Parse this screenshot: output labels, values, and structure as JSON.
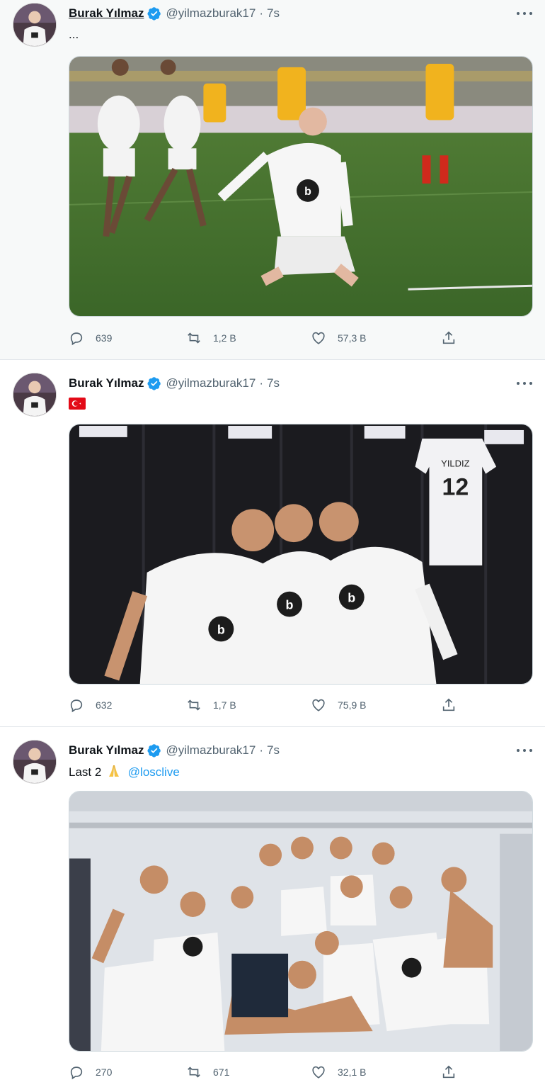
{
  "tweets": [
    {
      "author_name": "Burak Yılmaz",
      "handle": "@yilmazburak17",
      "separator": "·",
      "time": "7s",
      "text": "...",
      "media_icon": "photo-goal-celebration",
      "replies": "639",
      "retweets": "1,2 B",
      "likes": "57,3 B"
    },
    {
      "author_name": "Burak Yılmaz",
      "handle": "@yilmazburak17",
      "separator": "·",
      "time": "7s",
      "text_icon": "turkey-flag-icon",
      "media_icon": "photo-locker-room-three-players",
      "jersey_name": "YILDIZ",
      "jersey_number": "12",
      "replies": "632",
      "retweets": "1,7 B",
      "likes": "75,9 B"
    },
    {
      "author_name": "Burak Yılmaz",
      "handle": "@yilmazburak17",
      "separator": "·",
      "time": "7s",
      "text": "Last 2",
      "text_emoji": "folded-hands-icon",
      "mention": "@losclive",
      "media_icon": "photo-team-celebration",
      "replies": "270",
      "retweets": "671",
      "likes": "32,1 B"
    }
  ],
  "colors": {
    "accent": "#1d9bf0",
    "muted": "#536471",
    "text": "#0f1419",
    "first_tweet_bg": "#f7f9f9"
  }
}
